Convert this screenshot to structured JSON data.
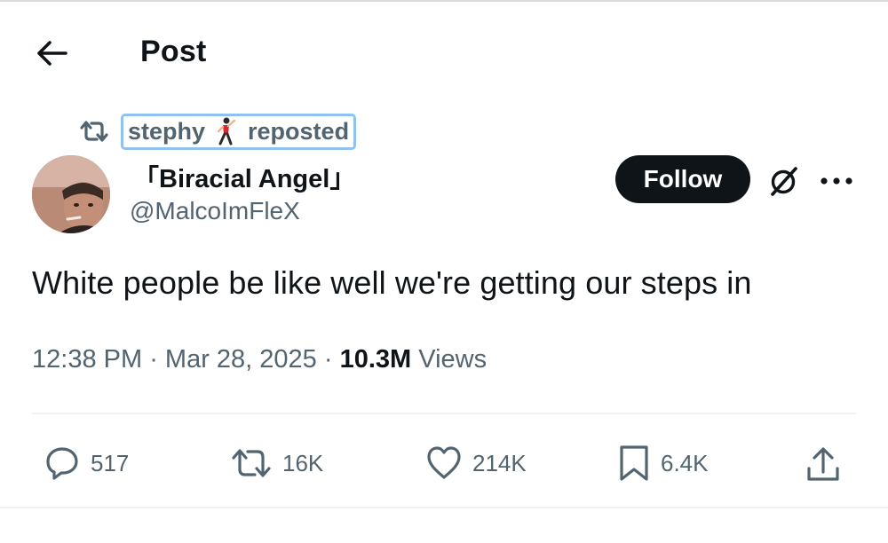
{
  "header": {
    "title": "Post"
  },
  "repost": {
    "name": "stephy",
    "emoji_icon": "dancing-man-icon",
    "suffix": "reposted"
  },
  "author": {
    "display_name": "「Biracial Angel」",
    "handle": "@MalcoImFleX"
  },
  "follow_label": "Follow",
  "tweet": {
    "text": "White people be like well we're getting our steps in"
  },
  "meta": {
    "time": "12:38 PM",
    "sep1": " · ",
    "date": "Mar 28, 2025",
    "sep2": " · ",
    "views_count": "10.3M",
    "views_label": " Views"
  },
  "actions": {
    "replies": "517",
    "reposts": "16K",
    "likes": "214K",
    "bookmarks": "6.4K"
  },
  "colors": {
    "text": "#0f1419",
    "secondary": "#536471",
    "follow_bg": "#0f1419",
    "highlight": "#8fc1f2"
  }
}
